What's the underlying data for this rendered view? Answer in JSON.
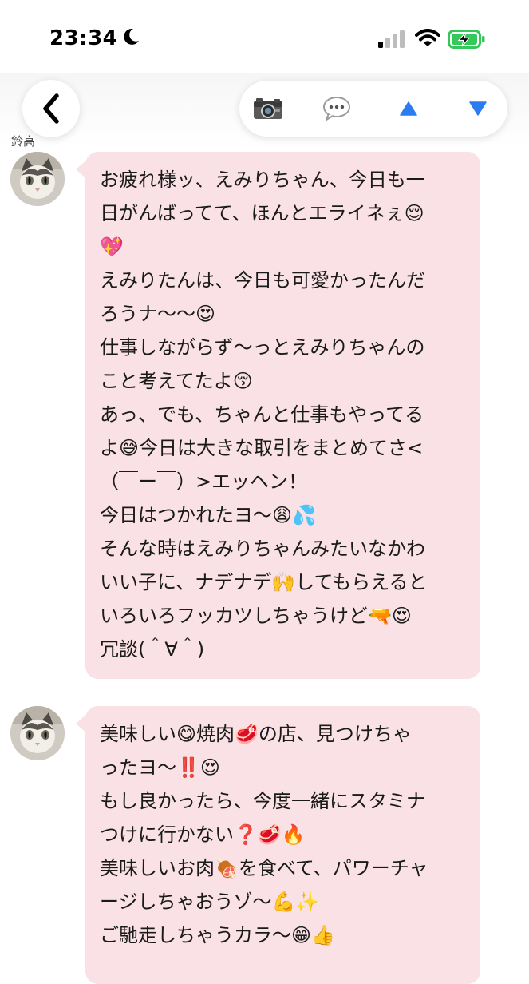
{
  "status_bar": {
    "time": "23:34",
    "icons": [
      "moon-icon",
      "cellular-signal-icon",
      "wifi-icon",
      "battery-charging-icon"
    ],
    "battery_color": "#34c759"
  },
  "nav": {
    "icons": [
      "back-chevron-icon",
      "camera-icon",
      "speech-bubble-icon",
      "up-triangle-icon",
      "down-triangle-icon"
    ],
    "accent_color": "#2a7cf0"
  },
  "chat": {
    "sender_name": "鈴高",
    "bubble_color": "#f9e1e6",
    "messages": [
      {
        "text": "お疲れ様ッ、えみりちゃん、今日も一\n日がんばってて、ほんとエライネぇ😌\n💖\nえみりたんは、今日も可愛かったんだ\nろうナ〜〜😍\n仕事しながらず〜っとえみりちゃんの\nこと考えてたよ😚\nあっ、でも、ちゃんと仕事もやってる\nよ😅今日は大きな取引をまとめてさ<\n（￣ー￣）>エッヘン！\n今日はつかれたヨ〜😩💦\nそんな時はえみりちゃんみたいなかわ\nいい子に、ナデナデ🙌してもらえると\nいろいろフッカツしちゃうけど🔫😍\n冗談(＾∀＾)"
      },
      {
        "text": "美味しい😋焼肉🥩の店、見つけちゃ\nったヨ〜‼️😍\nもし良かったら、今度一緒にスタミナ\nつけに行かない❓🥩🔥\n美味しいお肉🍖を食べて、パワーチャ\nージしちゃおうゾ〜💪✨\nご馳走しちゃうカラ〜😁👍"
      }
    ]
  }
}
